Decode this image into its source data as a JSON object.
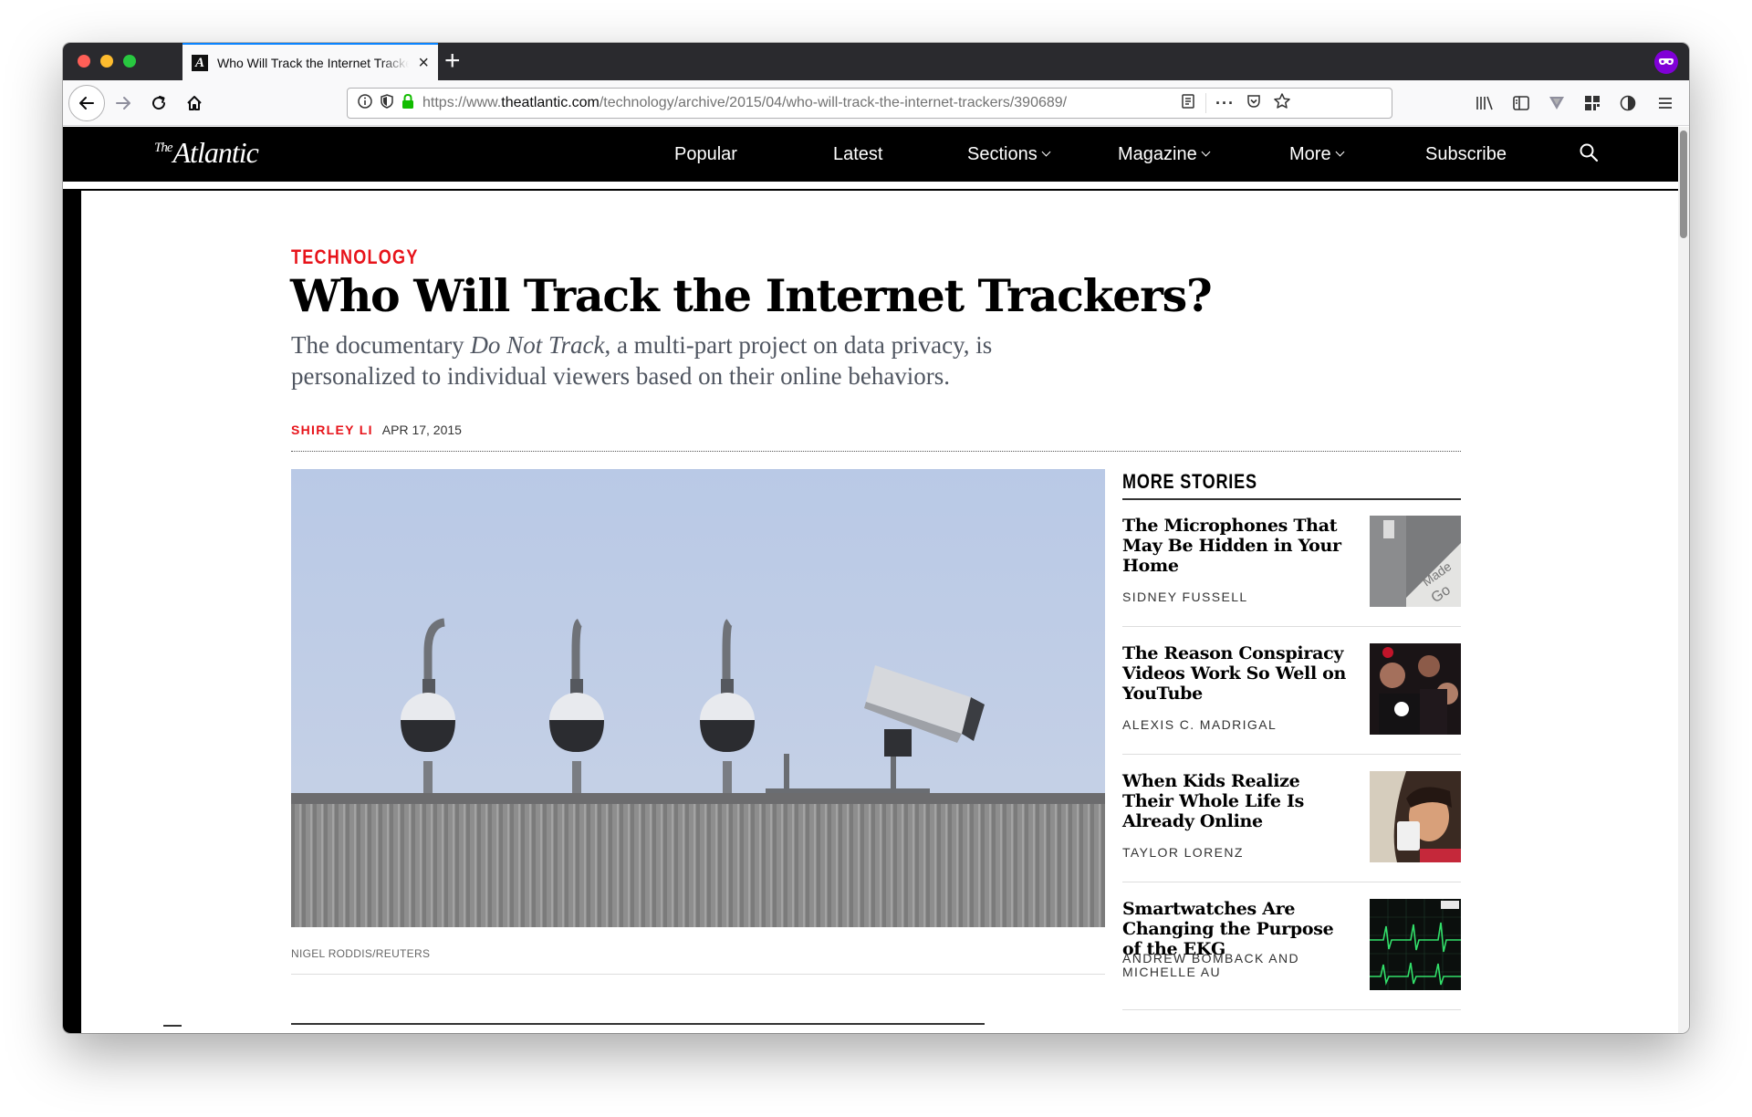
{
  "browser": {
    "tab_title": "Who Will Track the Internet Trackers?",
    "tab_favicon": "A",
    "url_prefix": "https://www.",
    "url_domain": "theatlantic.com",
    "url_path": "/technology/archive/2015/04/who-will-track-the-internet-trackers/390689/",
    "toolbar_icons": [
      "back-icon",
      "forward-icon",
      "reload-icon",
      "home-icon",
      "info-icon",
      "tracking-protection-icon",
      "lock-icon",
      "reader-view-icon",
      "page-actions-icon",
      "pocket-icon",
      "bookmark-star-icon",
      "library-icon",
      "sidebar-icon",
      "vivaldi-icon",
      "extensions-icon",
      "shield-icon",
      "menu-icon"
    ]
  },
  "site": {
    "logo_the": "The",
    "logo_name": "Atlantic",
    "nav": {
      "popular": "Popular",
      "latest": "Latest",
      "sections": "Sections",
      "magazine": "Magazine",
      "more": "More",
      "subscribe": "Subscribe"
    }
  },
  "article": {
    "section": "TECHNOLOGY",
    "headline": "Who Will Track the Internet Trackers?",
    "dek_before": "The documentary ",
    "dek_italic": "Do Not Track",
    "dek_after": ", a multi-part project on data privacy, is personalized to individual viewers based on their online behaviors.",
    "author": "SHIRLEY LI",
    "date": "APR 17, 2015",
    "photo_credit": "NIGEL RODDIS/REUTERS"
  },
  "sidebar": {
    "title": "MORE STORIES",
    "stories": [
      {
        "title": "The Microphones That May Be Hidden in Your Home",
        "author": "SIDNEY FUSSELL"
      },
      {
        "title": "The Reason Conspiracy Videos Work So Well on YouTube",
        "author": "ALEXIS C. MADRIGAL"
      },
      {
        "title": "When Kids Realize Their Whole Life Is Already Online",
        "author": "TAYLOR LORENZ"
      },
      {
        "title": "Smartwatches Are Changing the Purpose of the EKG",
        "author": "ANDREW BOMBACK AND MICHELLE AU"
      }
    ]
  },
  "colors": {
    "accent_red": "#e7131a",
    "nav_bg": "#000000",
    "tab_accent": "#0a84ff"
  }
}
